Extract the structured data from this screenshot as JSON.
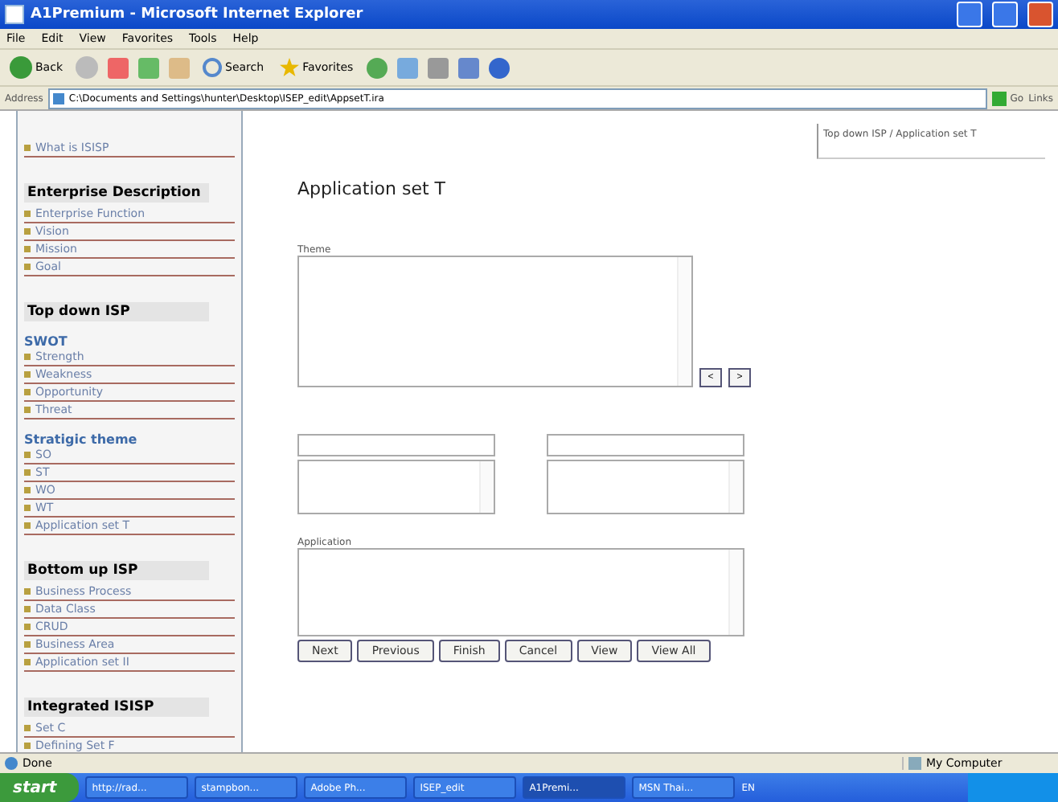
{
  "window": {
    "title": "A1Premium - Microsoft Internet Explorer"
  },
  "menu": [
    "File",
    "Edit",
    "View",
    "Favorites",
    "Tools",
    "Help"
  ],
  "toolbar": {
    "back": "Back",
    "search": "Search",
    "favorites": "Favorites"
  },
  "address_bar": {
    "label": "Address",
    "value": "C:\\Documents and Settings\\hunter\\Desktop\\ISEP_edit\\AppsetT.ira",
    "go": "Go",
    "links": "Links"
  },
  "sidebar": [
    {
      "kind": "item",
      "label": "What is ISISP"
    },
    {
      "kind": "heading",
      "label": "Enterprise Description"
    },
    {
      "kind": "item",
      "label": "Enterprise Function"
    },
    {
      "kind": "item",
      "label": "Vision"
    },
    {
      "kind": "item",
      "label": "Mission"
    },
    {
      "kind": "item",
      "label": "Goal"
    },
    {
      "kind": "heading",
      "label": "Top down ISP"
    },
    {
      "kind": "subheading",
      "label": "SWOT"
    },
    {
      "kind": "item",
      "label": "Strength"
    },
    {
      "kind": "item",
      "label": "Weakness"
    },
    {
      "kind": "item",
      "label": "Opportunity"
    },
    {
      "kind": "item",
      "label": "Threat"
    },
    {
      "kind": "subheading",
      "label": "Stratigic theme"
    },
    {
      "kind": "item",
      "label": "SO"
    },
    {
      "kind": "item",
      "label": "ST"
    },
    {
      "kind": "item",
      "label": "WO"
    },
    {
      "kind": "item",
      "label": "WT"
    },
    {
      "kind": "item",
      "label": "Application set T"
    },
    {
      "kind": "heading",
      "label": "Bottom up ISP"
    },
    {
      "kind": "item",
      "label": "Business Process"
    },
    {
      "kind": "item",
      "label": "Data Class"
    },
    {
      "kind": "item",
      "label": "CRUD"
    },
    {
      "kind": "item",
      "label": "Business Area"
    },
    {
      "kind": "item",
      "label": "Application set II"
    },
    {
      "kind": "heading",
      "label": "Integrated ISISP"
    },
    {
      "kind": "item",
      "label": "Set C"
    },
    {
      "kind": "item",
      "label": "Defining Set F"
    }
  ],
  "breadcrumb": "Top down ISP / Application set T",
  "page_title": "Application set T",
  "theme": {
    "label": "Theme",
    "move_buttons": [
      "<",
      ">"
    ]
  },
  "application": {
    "label": "Application"
  },
  "buttons": [
    "Next",
    "Previous",
    "Finish",
    "Cancel",
    "View",
    "View All"
  ],
  "status_bar": {
    "text": "Done",
    "zone": "My Computer"
  },
  "taskbar": {
    "start": "start",
    "items": [
      "http://rad...",
      "stampbon...",
      "Adobe Ph...",
      "ISEP_edit",
      "A1Premi...",
      "MSN Thai..."
    ],
    "language": "EN"
  }
}
